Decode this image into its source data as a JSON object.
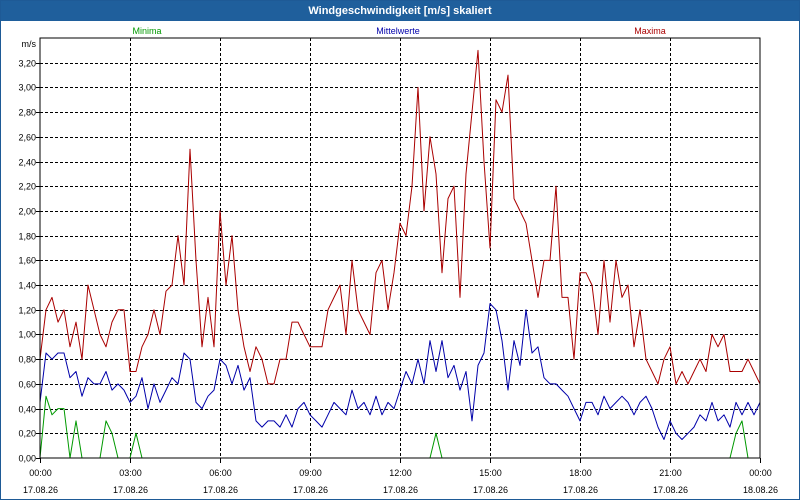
{
  "window": {
    "title": "Windgeschwindigkeit [m/s] skaliert"
  },
  "chart_data": {
    "type": "line",
    "title": "Windgeschwindigkeit [m/s] skaliert",
    "ylabel": "m/s",
    "xlabel": "",
    "ylim": [
      0,
      3.4
    ],
    "yticks": [
      0,
      0.2,
      0.4,
      0.6,
      0.8,
      1.0,
      1.2,
      1.4,
      1.6,
      1.8,
      2.0,
      2.2,
      2.4,
      2.6,
      2.8,
      3.0,
      3.2
    ],
    "ytick_labels": [
      "0,00",
      "0,20",
      "0,40",
      "0,60",
      "0,80",
      "1,00",
      "1,20",
      "1,40",
      "1,60",
      "1,80",
      "2,00",
      "2,20",
      "2,40",
      "2,60",
      "2,80",
      "3,00",
      "3,20"
    ],
    "xlim": [
      0,
      24
    ],
    "x_unit": "hours since 17.08.26 00:00",
    "xticks": [
      {
        "time": "00:00",
        "date": "17.08.26"
      },
      {
        "time": "03:00",
        "date": "17.08.26"
      },
      {
        "time": "06:00",
        "date": "17.08.26"
      },
      {
        "time": "09:00",
        "date": "17.08.26"
      },
      {
        "time": "12:00",
        "date": "17.08.26"
      },
      {
        "time": "15:00",
        "date": "17.08.26"
      },
      {
        "time": "18:00",
        "date": "17.08.26"
      },
      {
        "time": "21:00",
        "date": "17.08.26"
      },
      {
        "time": "00:00",
        "date": "18.08.26"
      }
    ],
    "grid": true,
    "legend_position": "top",
    "x": [
      0,
      0.2,
      0.4,
      0.6,
      0.8,
      1,
      1.2,
      1.4,
      1.6,
      1.8,
      2,
      2.2,
      2.4,
      2.6,
      2.8,
      3,
      3.2,
      3.4,
      3.6,
      3.8,
      4,
      4.2,
      4.4,
      4.6,
      4.8,
      5,
      5.2,
      5.4,
      5.6,
      5.8,
      6,
      6.2,
      6.4,
      6.6,
      6.8,
      7,
      7.2,
      7.4,
      7.6,
      7.8,
      8,
      8.2,
      8.4,
      8.6,
      8.8,
      9,
      9.2,
      9.4,
      9.6,
      9.8,
      10,
      10.2,
      10.4,
      10.6,
      10.8,
      11,
      11.2,
      11.4,
      11.6,
      11.8,
      12,
      12.2,
      12.4,
      12.6,
      12.8,
      13,
      13.2,
      13.4,
      13.6,
      13.8,
      14,
      14.2,
      14.4,
      14.6,
      14.8,
      15,
      15.2,
      15.4,
      15.6,
      15.8,
      16,
      16.2,
      16.4,
      16.6,
      16.8,
      17,
      17.2,
      17.4,
      17.6,
      17.8,
      18,
      18.2,
      18.4,
      18.6,
      18.8,
      19,
      19.2,
      19.4,
      19.6,
      19.8,
      20,
      20.2,
      20.4,
      20.6,
      20.8,
      21,
      21.2,
      21.4,
      21.6,
      21.8,
      22,
      22.2,
      22.4,
      22.6,
      22.8,
      23,
      23.2,
      23.4,
      23.6,
      23.8,
      24
    ],
    "series": [
      {
        "name": "Minima",
        "color": "#009900",
        "values": [
          0.0,
          0.5,
          0.35,
          0.4,
          0.4,
          0.0,
          0.3,
          0.0,
          0.0,
          0.0,
          0.0,
          0.3,
          0.2,
          0.0,
          0.0,
          0.0,
          0.2,
          0.0,
          0.0,
          0.0,
          0.0,
          0.0,
          0.0,
          0.0,
          0.0,
          0.0,
          0.0,
          0.0,
          0.0,
          0.0,
          0.0,
          0.0,
          0.0,
          0.0,
          0.0,
          0.0,
          0.0,
          0.0,
          0.0,
          0.0,
          0.0,
          0.0,
          0.0,
          0.0,
          0.0,
          0.0,
          0.0,
          0.0,
          0.0,
          0.0,
          0.0,
          0.0,
          0.0,
          0.0,
          0.0,
          0.0,
          0.0,
          0.0,
          0.0,
          0.0,
          0.0,
          0.0,
          0.0,
          0.0,
          0.0,
          0.0,
          0.2,
          0.0,
          0.0,
          0.0,
          0.0,
          0.0,
          0.0,
          0.0,
          0.0,
          0.0,
          0.0,
          0.0,
          0.0,
          0.0,
          0.0,
          0.0,
          0.0,
          0.0,
          0.0,
          0.0,
          0.0,
          0.0,
          0.0,
          0.0,
          0.0,
          0.0,
          0.0,
          0.0,
          0.0,
          0.0,
          0.0,
          0.0,
          0.0,
          0.0,
          0.0,
          0.0,
          0.0,
          0.0,
          0.0,
          0.0,
          0.0,
          0.0,
          0.0,
          0.0,
          0.0,
          0.0,
          0.0,
          0.0,
          0.0,
          0.0,
          0.2,
          0.3,
          0.0,
          0.0,
          0.0
        ]
      },
      {
        "name": "Mittelwerte",
        "color": "#0000aa",
        "values": [
          0.45,
          0.85,
          0.8,
          0.85,
          0.85,
          0.65,
          0.7,
          0.5,
          0.65,
          0.6,
          0.6,
          0.7,
          0.55,
          0.6,
          0.55,
          0.45,
          0.5,
          0.65,
          0.4,
          0.6,
          0.45,
          0.55,
          0.65,
          0.6,
          0.85,
          0.8,
          0.45,
          0.4,
          0.5,
          0.55,
          0.8,
          0.75,
          0.6,
          0.75,
          0.55,
          0.65,
          0.3,
          0.25,
          0.3,
          0.3,
          0.25,
          0.35,
          0.25,
          0.4,
          0.45,
          0.35,
          0.3,
          0.25,
          0.35,
          0.45,
          0.4,
          0.35,
          0.55,
          0.4,
          0.45,
          0.35,
          0.5,
          0.35,
          0.45,
          0.4,
          0.55,
          0.7,
          0.6,
          0.8,
          0.6,
          0.95,
          0.7,
          0.95,
          0.65,
          0.75,
          0.55,
          0.7,
          0.3,
          0.75,
          0.85,
          1.25,
          1.2,
          0.95,
          0.55,
          0.95,
          0.75,
          1.2,
          0.85,
          0.9,
          0.65,
          0.6,
          0.6,
          0.55,
          0.5,
          0.4,
          0.3,
          0.45,
          0.45,
          0.35,
          0.5,
          0.4,
          0.45,
          0.5,
          0.45,
          0.35,
          0.45,
          0.5,
          0.4,
          0.25,
          0.15,
          0.3,
          0.2,
          0.15,
          0.2,
          0.25,
          0.35,
          0.3,
          0.45,
          0.3,
          0.35,
          0.25,
          0.45,
          0.35,
          0.45,
          0.35,
          0.45
        ]
      },
      {
        "name": "Maxima",
        "color": "#aa0000",
        "values": [
          0.8,
          1.2,
          1.3,
          1.1,
          1.2,
          0.9,
          1.1,
          0.8,
          1.4,
          1.2,
          1.0,
          0.9,
          1.1,
          1.2,
          1.2,
          0.7,
          0.7,
          0.9,
          1.0,
          1.2,
          1.0,
          1.35,
          1.4,
          1.8,
          1.4,
          2.5,
          1.6,
          0.9,
          1.3,
          0.9,
          2.0,
          1.4,
          1.8,
          1.2,
          0.9,
          0.7,
          0.9,
          0.8,
          0.6,
          0.6,
          0.8,
          0.8,
          1.1,
          1.1,
          1.0,
          0.9,
          0.9,
          0.9,
          1.2,
          1.3,
          1.4,
          1.0,
          1.6,
          1.2,
          1.1,
          1.0,
          1.5,
          1.6,
          1.2,
          1.5,
          1.9,
          1.8,
          2.2,
          3.0,
          2.0,
          2.6,
          2.3,
          1.5,
          2.1,
          2.2,
          1.3,
          2.3,
          2.8,
          3.3,
          2.4,
          1.7,
          2.9,
          2.8,
          3.1,
          2.1,
          2.0,
          1.9,
          1.6,
          1.3,
          1.6,
          1.6,
          2.2,
          1.3,
          1.3,
          0.8,
          1.5,
          1.5,
          1.4,
          1.0,
          1.6,
          1.1,
          1.6,
          1.3,
          1.4,
          0.9,
          1.2,
          0.8,
          0.7,
          0.6,
          0.8,
          0.9,
          0.6,
          0.7,
          0.6,
          0.7,
          0.8,
          0.7,
          1.0,
          0.9,
          1.0,
          0.7,
          0.7,
          0.7,
          0.8,
          0.7,
          0.6
        ]
      }
    ]
  }
}
